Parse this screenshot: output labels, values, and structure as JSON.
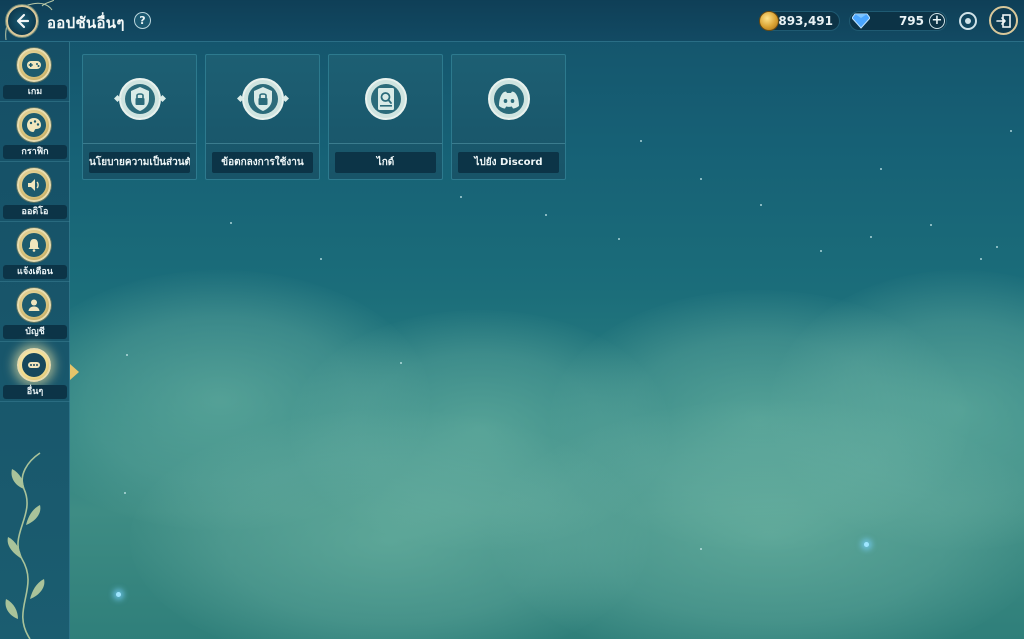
{
  "header": {
    "title": "ออปชันอื่นๆ",
    "help_label": "?",
    "gold_amount": "893,491",
    "gem_amount": "795",
    "plus_label": "+"
  },
  "sidebar": {
    "items": [
      {
        "label": "เกม",
        "icon": "gamepad-icon"
      },
      {
        "label": "กราฟิก",
        "icon": "palette-icon"
      },
      {
        "label": "ออดิโอ",
        "icon": "speaker-icon"
      },
      {
        "label": "แจ้งเตือน",
        "icon": "bell-icon"
      },
      {
        "label": "บัญชี",
        "icon": "user-icon"
      },
      {
        "label": "อื่นๆ",
        "icon": "more-icon",
        "active": true
      }
    ]
  },
  "cards": [
    {
      "label": "นโยบายความเป็นส่วนตัว",
      "icon": "shield-lock-icon"
    },
    {
      "label": "ข้อตกลงการใช้งาน",
      "icon": "shield-lock-icon"
    },
    {
      "label": "ไกด์",
      "icon": "guide-book-icon"
    },
    {
      "label": "ไปยัง Discord",
      "icon": "discord-icon"
    }
  ],
  "colors": {
    "accent_gold": "#d9c89a",
    "panel": "#185468",
    "label_bg": "#0c3447"
  }
}
